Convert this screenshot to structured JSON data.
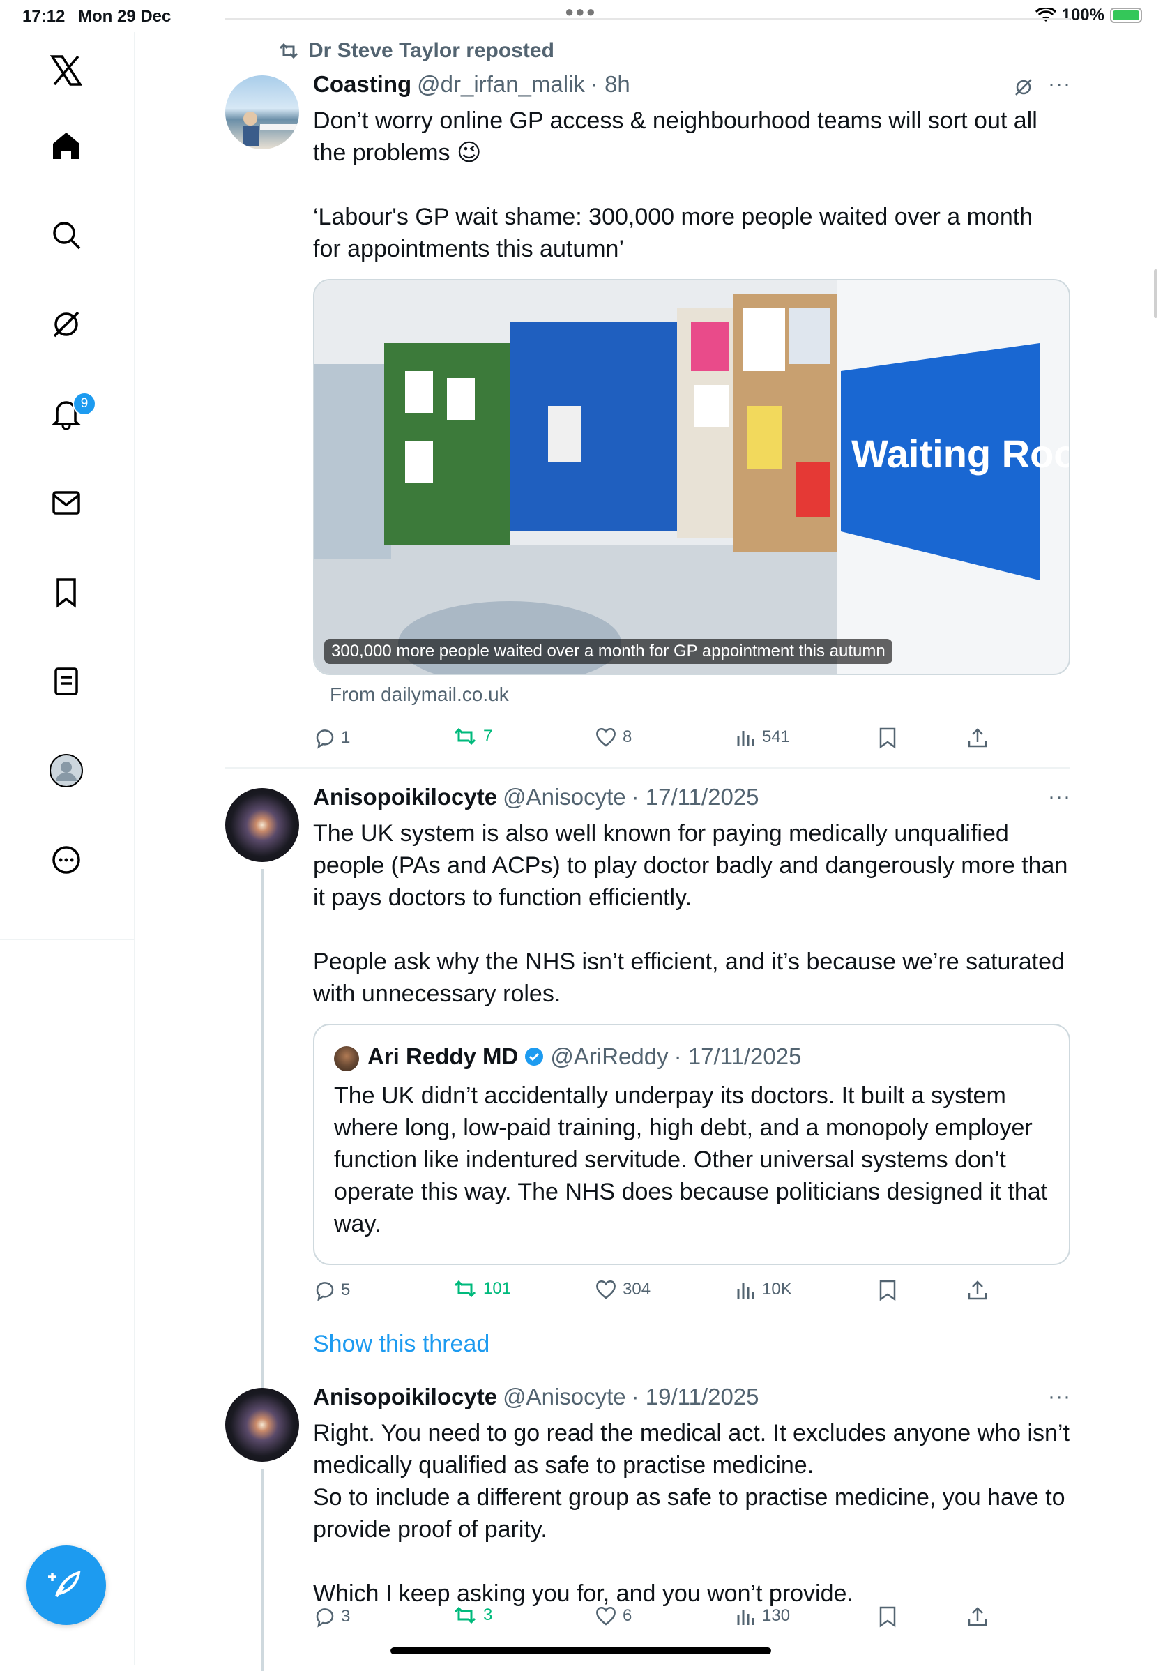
{
  "status_bar": {
    "time": "17:12",
    "date": "Mon 29 Dec",
    "battery": "100%"
  },
  "sidebar": {
    "notification_count": "9"
  },
  "tweets": [
    {
      "repost_by": "Dr Steve Taylor reposted",
      "name": "Coasting",
      "handle": "@dr_irfan_malik",
      "time": "· 8h",
      "text": "Don’t worry online GP access & neighbourhood teams will sort out all the problems 😉\n\n‘Labour's GP wait shame: 300,000 more people waited over a month for appointments this autumn’",
      "card": {
        "caption": "300,000 more people waited over a month for GP appointment this autumn",
        "source": "From dailymail.co.uk",
        "sign_text": "Waiting Room"
      },
      "stats": {
        "replies": "1",
        "reposts": "7",
        "likes": "8",
        "views": "541"
      }
    },
    {
      "name": "Anisopoikilocyte",
      "handle": "@Anisocyte",
      "time": "· 17/11/2025",
      "text": "The UK system is also well known for paying medically unqualified people (PAs and ACPs) to play doctor badly and dangerously more than it pays doctors to function efficiently.\n\nPeople ask why the NHS isn’t efficient, and it’s because we’re saturated with unnecessary roles.",
      "quote": {
        "name": "Ari Reddy MD",
        "handle": "@AriReddy",
        "time": "· 17/11/2025",
        "text": "The UK didn’t accidentally underpay its doctors. It built a system where long, low-paid training, high debt, and a monopoly employer function like indentured servitude. Other universal systems don’t operate this way. The NHS does because politicians designed it that way."
      },
      "stats": {
        "replies": "5",
        "reposts": "101",
        "likes": "304",
        "views": "10K"
      },
      "show_thread": "Show this thread"
    },
    {
      "name": "Anisopoikilocyte",
      "handle": "@Anisocyte",
      "time": "· 19/11/2025",
      "text": "Right. You need to go read the medical act. It excludes anyone who isn’t medically qualified as safe to practise medicine.\nSo to include a different group as safe to practise medicine, you have to provide proof of parity.\n\nWhich I keep asking you for, and you won’t provide.",
      "stats": {
        "replies": "3",
        "reposts": "3",
        "likes": "6",
        "views": "130"
      }
    }
  ]
}
